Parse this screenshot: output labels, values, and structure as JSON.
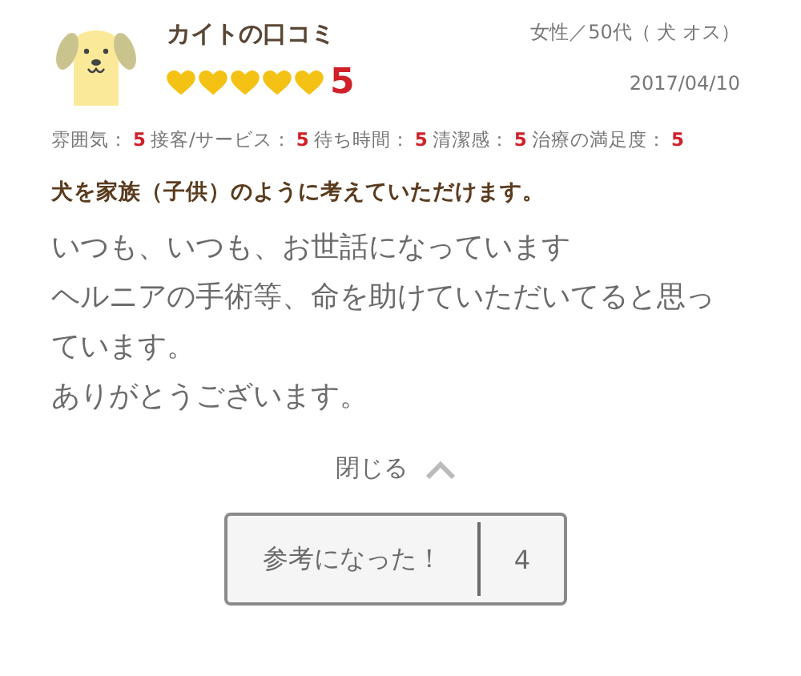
{
  "review": {
    "title": "カイトの口コミ",
    "profile": "女性／50代（ 犬 オス）",
    "stars": 5,
    "rating": "5",
    "date": "2017/04/10"
  },
  "scores": [
    {
      "label": "雰囲気：",
      "value": "5"
    },
    {
      "label": "接客/サービス：",
      "value": "5"
    },
    {
      "label": "待ち時間：",
      "value": "5"
    },
    {
      "label": "清潔感：",
      "value": "5"
    },
    {
      "label": "治療の満足度：",
      "value": "5"
    }
  ],
  "headline": "犬を家族（子供）のように考えていただけます。",
  "body": [
    "いつも、いつも、お世話になっています",
    "ヘルニアの手術等、命を助けていただいてると思っています。",
    "ありがとうございます。"
  ],
  "close": {
    "label": "閉じる"
  },
  "helpful": {
    "label": "参考になった！",
    "count": "4"
  }
}
